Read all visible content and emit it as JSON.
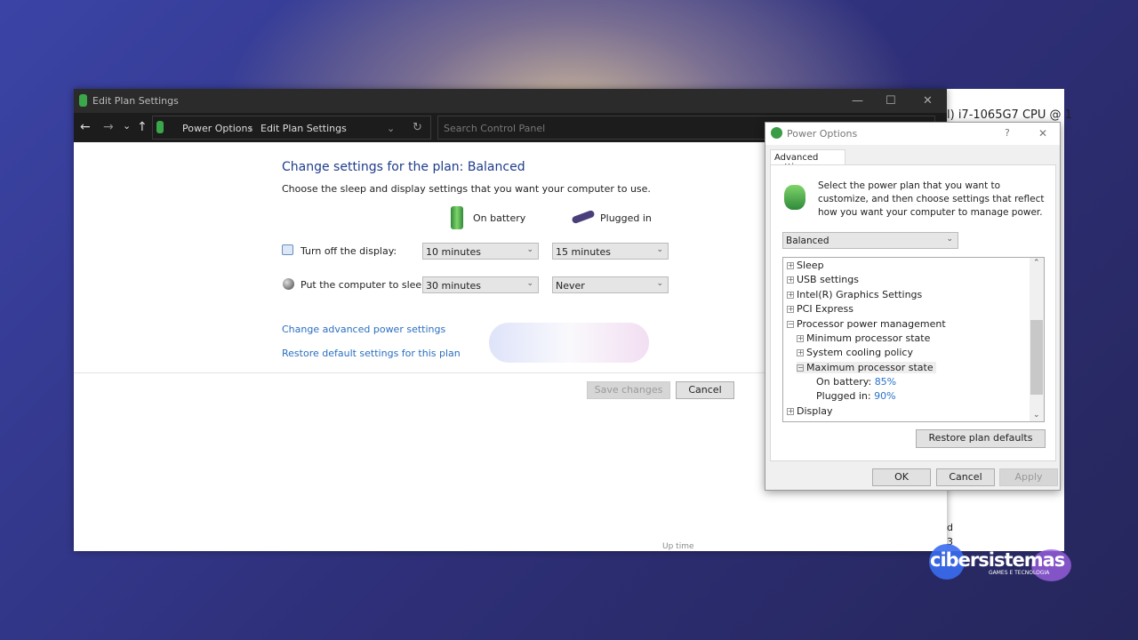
{
  "background_window": {
    "cpu_text": "l) i7-1065G7 CPU @ 1",
    "frag1": "d",
    "frag2": "3",
    "frag3": "Up time"
  },
  "main_window": {
    "title": "Edit Plan Settings",
    "controls": {
      "minimize": "—",
      "maximize": "☐",
      "close": "✕"
    },
    "nav": {
      "back": "←",
      "forward": "→",
      "recent": "⌄",
      "up": "↑",
      "refresh": "↻"
    },
    "breadcrumb": [
      "Power Options",
      "Edit Plan Settings"
    ],
    "breadcrumb_sep": "›",
    "search_placeholder": "Search Control Panel",
    "heading": "Change settings for the plan: Balanced",
    "subheading": "Choose the sleep and display settings that you want your computer to use.",
    "columns": {
      "battery": "On battery",
      "plugged": "Plugged in"
    },
    "rows": [
      {
        "label": "Turn off the display:",
        "battery": "10 minutes",
        "plugged": "15 minutes"
      },
      {
        "label": "Put the computer to sleep:",
        "battery": "30 minutes",
        "plugged": "Never"
      }
    ],
    "links": {
      "advanced": "Change advanced power settings",
      "restore": "Restore default settings for this plan"
    },
    "buttons": {
      "save": "Save changes",
      "cancel": "Cancel"
    }
  },
  "dialog": {
    "title": "Power Options",
    "help": "?",
    "close": "✕",
    "tab": "Advanced settings",
    "description": "Select the power plan that you want to customize, and then choose settings that reflect how you want your computer to manage power.",
    "plan": "Balanced",
    "tree": [
      {
        "label": "Sleep",
        "state": "+"
      },
      {
        "label": "USB settings",
        "state": "+"
      },
      {
        "label": "Intel(R) Graphics Settings",
        "state": "+"
      },
      {
        "label": "PCI Express",
        "state": "+"
      },
      {
        "label": "Processor power management",
        "state": "−"
      },
      {
        "label": "Minimum processor state",
        "state": "+"
      },
      {
        "label": "System cooling policy",
        "state": "+"
      },
      {
        "label": "Maximum processor state",
        "state": "−"
      },
      {
        "label": "On battery:",
        "value": "85%"
      },
      {
        "label": "Plugged in:",
        "value": "90%"
      },
      {
        "label": "Display",
        "state": "+"
      }
    ],
    "restore_defaults": "Restore plan defaults",
    "ok": "OK",
    "cancel": "Cancel",
    "apply": "Apply"
  },
  "watermark": {
    "brand": "cibersistemas",
    "tagline": "GAMES E TECNOLOGIA"
  },
  "colors": {
    "heading": "#1e3c8c",
    "link": "#2a6fc0",
    "value": "#2a72c8",
    "titlebar": "#2b2b2b"
  }
}
